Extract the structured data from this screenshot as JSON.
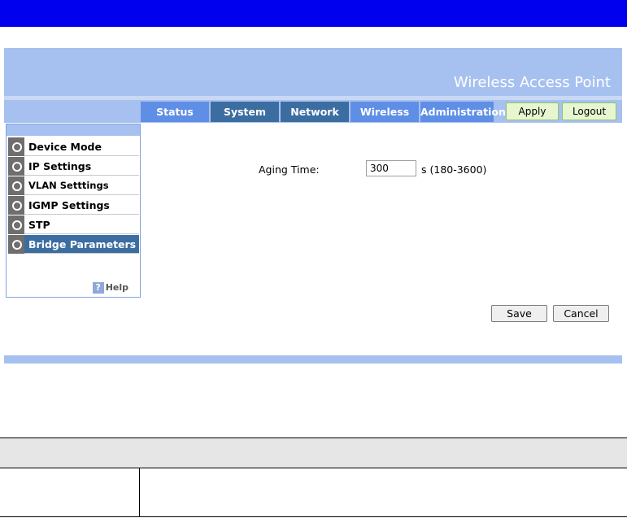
{
  "banner": {
    "title": "Wireless Access Point"
  },
  "nav": {
    "tabs": [
      {
        "label": "Status"
      },
      {
        "label": "System"
      },
      {
        "label": "Network"
      },
      {
        "label": "Wireless"
      },
      {
        "label": "Administration"
      }
    ],
    "apply_label": "Apply",
    "logout_label": "Logout"
  },
  "sidebar": {
    "items": [
      {
        "label": "Device Mode"
      },
      {
        "label": "IP Settings"
      },
      {
        "label": "VLAN Setttings"
      },
      {
        "label": "IGMP Settings"
      },
      {
        "label": "STP"
      },
      {
        "label": "Bridge Parameters",
        "active": true
      }
    ],
    "help_label": "Help",
    "help_icon": "?"
  },
  "form": {
    "aging_time_label": "Aging Time:",
    "aging_time_value": "300",
    "aging_time_unit": "s (180-3600)",
    "save_label": "Save",
    "cancel_label": "Cancel"
  },
  "colors": {
    "topbar": "#0000ee",
    "banner": "#a6c1ef",
    "tab_light": "#5f8ee6",
    "tab_dark": "#3c6da0",
    "button_green": "#e6f7d0"
  }
}
